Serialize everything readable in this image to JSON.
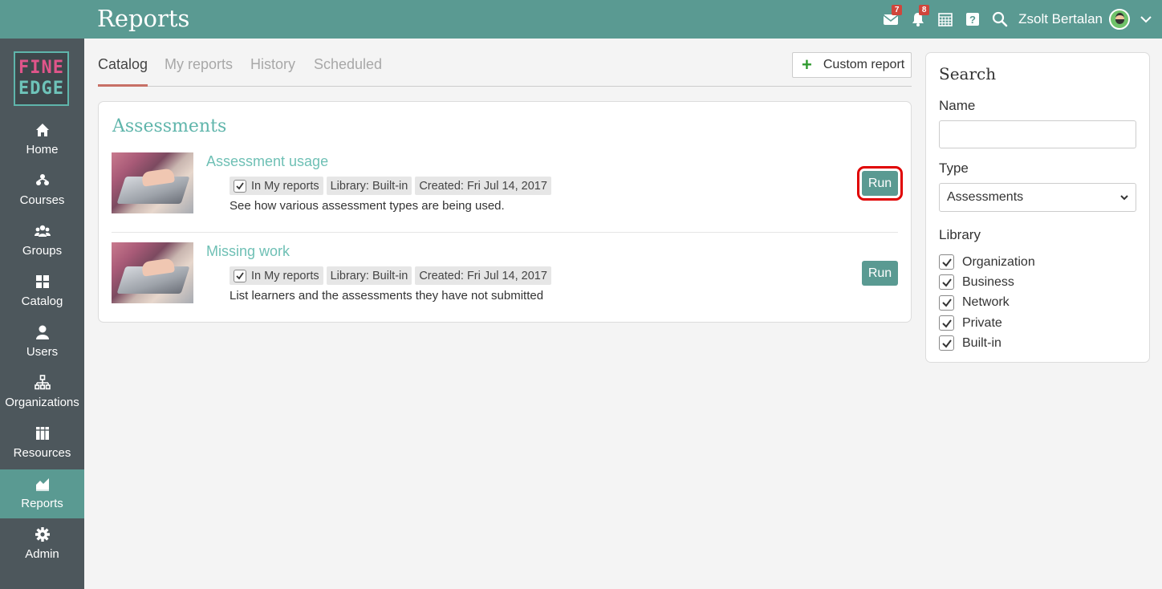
{
  "header": {
    "title": "Reports",
    "messages_badge": "7",
    "notifications_badge": "8",
    "user_name": "Zsolt Bertalan"
  },
  "logo": {
    "line1": "FINE",
    "line2": "EDGE"
  },
  "sidebar": {
    "items": [
      {
        "label": "Home",
        "icon": "home-icon"
      },
      {
        "label": "Courses",
        "icon": "courses-icon"
      },
      {
        "label": "Groups",
        "icon": "groups-icon"
      },
      {
        "label": "Catalog",
        "icon": "catalog-icon"
      },
      {
        "label": "Users",
        "icon": "users-icon"
      },
      {
        "label": "Organizations",
        "icon": "organizations-icon"
      },
      {
        "label": "Resources",
        "icon": "resources-icon"
      },
      {
        "label": "Reports",
        "icon": "reports-icon",
        "active": true
      },
      {
        "label": "Admin",
        "icon": "admin-icon"
      }
    ]
  },
  "tabs": {
    "items": [
      "Catalog",
      "My reports",
      "History",
      "Scheduled"
    ],
    "active": "Catalog",
    "custom_report_label": "Custom report"
  },
  "catalog": {
    "section_title": "Assessments",
    "reports": [
      {
        "name": "Assessment usage",
        "tag_my_reports": "In My reports",
        "tag_library": "Library: Built-in",
        "tag_created": "Created: Fri Jul 14, 2017",
        "description": "See how various assessment types are being used.",
        "run_label": "Run"
      },
      {
        "name": "Missing work",
        "tag_my_reports": "In My reports",
        "tag_library": "Library: Built-in",
        "tag_created": "Created: Fri Jul 14, 2017",
        "description": "List learners and the assessments they have not submitted",
        "run_label": "Run"
      }
    ]
  },
  "search": {
    "title": "Search",
    "name_label": "Name",
    "name_value": "",
    "type_label": "Type",
    "type_value": "Assessments",
    "library_label": "Library",
    "library_options": [
      "Organization",
      "Business",
      "Network",
      "Private",
      "Built-in"
    ]
  },
  "colors": {
    "header_bg": "#5a9a92",
    "sidebar_bg": "#4d575c",
    "accent_teal": "#5fb5ab",
    "tab_underline": "#c77066",
    "badge_red": "#d0453b",
    "highlight_red": "#e00000"
  }
}
